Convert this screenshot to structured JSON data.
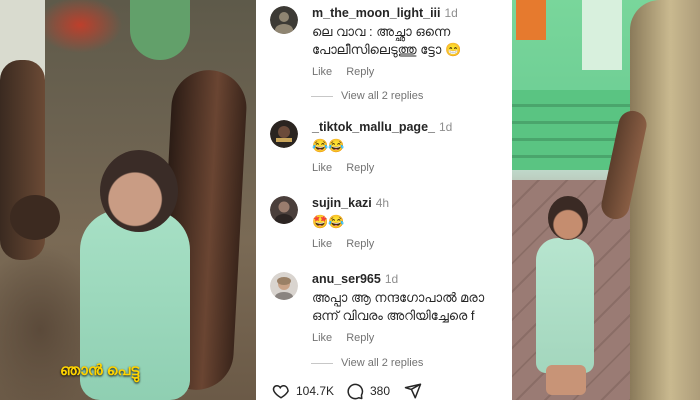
{
  "left_photo": {
    "caption": "ഞാൻ പെട്ടു"
  },
  "comments": [
    {
      "username": "m_the_moon_light_iii",
      "age": "1d",
      "text": "ലെ വാവ : അച്ഛാ ഒന്നെ\nപോലീസിലെടുത്തു ട്ടോ 😁",
      "like": "Like",
      "reply": "Reply",
      "view_replies": "View all 2 replies"
    },
    {
      "username": "_tiktok_mallu_page_",
      "age": "1d",
      "text": "😂😂",
      "like": "Like",
      "reply": "Reply"
    },
    {
      "username": "sujin_kazi",
      "age": "4h",
      "text": "🤩😂",
      "like": "Like",
      "reply": "Reply"
    },
    {
      "username": "anu_ser965",
      "age": "1d",
      "text": "അപ്പാ ആ നന്ദഗോപാൽ മരാ\nഒന്ന് വിവരം അറിയിച്ചേരെ f",
      "like": "Like",
      "reply": "Reply",
      "view_replies": "View all 2 replies"
    }
  ],
  "footer": {
    "likes": "104.7K",
    "comments": "380"
  },
  "icons": [
    "heart-icon",
    "comment-icon",
    "share-icon"
  ]
}
